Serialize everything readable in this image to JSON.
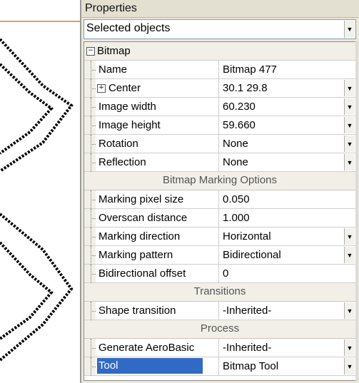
{
  "panel_title": "Properties",
  "selector_value": "Selected objects",
  "category": "Bitmap",
  "rows": [
    {
      "label": "Name",
      "value": "Bitmap 477",
      "dropdown": false
    },
    {
      "label": "Center",
      "value": "30.1 29.8",
      "dropdown": true,
      "expandable": true
    },
    {
      "label": "Image width",
      "value": "60.230",
      "dropdown": true
    },
    {
      "label": "Image height",
      "value": "59.660",
      "dropdown": true
    },
    {
      "label": "Rotation",
      "value": "None",
      "dropdown": true
    },
    {
      "label": "Reflection",
      "value": "None",
      "dropdown": true
    }
  ],
  "marking_header": "Bitmap Marking Options",
  "marking_rows": [
    {
      "label": "Marking pixel size",
      "value": "0.050",
      "dropdown": false
    },
    {
      "label": "Overscan distance",
      "value": "1.000",
      "dropdown": false
    },
    {
      "label": "Marking direction",
      "value": "Horizontal",
      "dropdown": true
    },
    {
      "label": "Marking pattern",
      "value": "Bidirectional",
      "dropdown": true
    },
    {
      "label": "Bidirectional offset",
      "value": "0",
      "dropdown": false
    }
  ],
  "transitions_header": "Transitions",
  "transitions_rows": [
    {
      "label": "Shape transition",
      "value": "-Inherited-",
      "dropdown": true
    }
  ],
  "process_header": "Process",
  "process_rows": [
    {
      "label": "Generate AeroBasic",
      "value": "-Inherited-",
      "dropdown": true
    },
    {
      "label": "Tool",
      "value": "Bitmap Tool",
      "dropdown": true,
      "selected": true
    }
  ],
  "icons": {
    "dropdown": "dropdown-arrow-icon",
    "expand": "plus-box-icon",
    "collapse": "minus-box-icon"
  },
  "colors": {
    "selection": "#316ac5",
    "panel": "#ece9d8"
  }
}
